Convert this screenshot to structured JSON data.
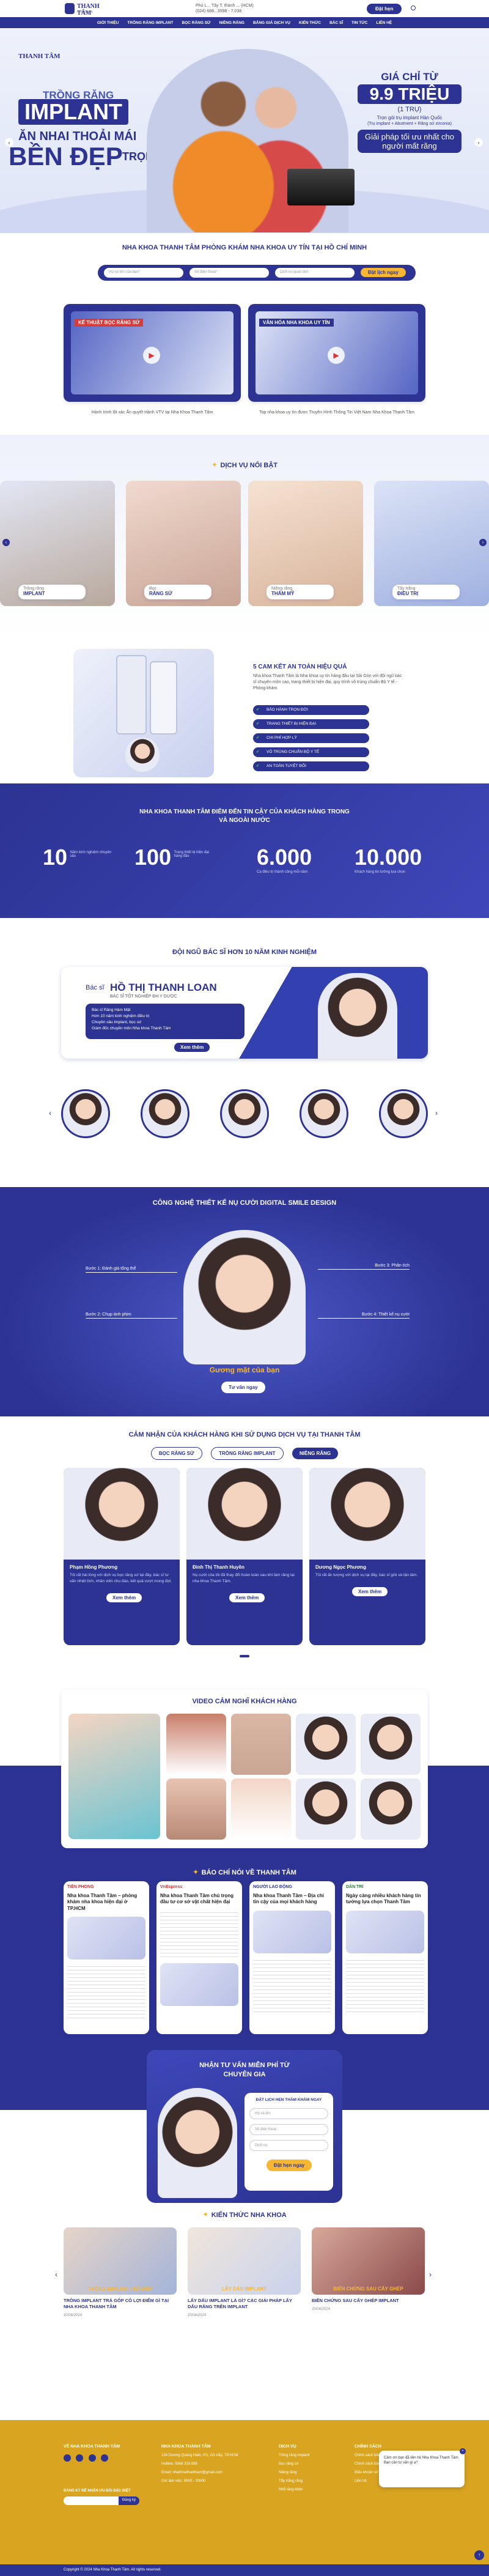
{
  "topbar": {
    "brand": "THANH TÂM",
    "sub": "NHA KHOA",
    "addr": "Phú L... Tây T. thành ... (HCM)",
    "phone": "(024) 688...3598 - 7.038",
    "cta": "Đặt hẹn"
  },
  "nav": [
    "GIỚI THIỆU",
    "TRỒNG RĂNG IMPLANT",
    "BỌC RĂNG SỨ",
    "NIỀNG RĂNG",
    "BẢNG GIÁ DỊCH VỤ",
    "KIẾN THỨC",
    "BÁC SĨ",
    "TIN TỨC",
    "LIÊN HỆ"
  ],
  "hero": {
    "brand": "THANH TÂM",
    "l1": "TRỒNG RĂNG",
    "l2": "IMPLANT",
    "l3": "ĂN NHAI THOẢI MÁI",
    "l4": "BỀN ĐẸP",
    "l5": "TRỌN ĐỜI",
    "price_pre": "GIÁ CHỈ TỪ",
    "price": "9.9 TRIỆU",
    "unit": "(1 TRỤ)",
    "p1": "Trọn gói trụ implant Hàn Quốc",
    "p2": "(Trụ implant + Abutment + Răng sứ zirconia)",
    "p3": "Giải pháp tối ưu nhất cho",
    "p4": "người mất răng"
  },
  "intro": {
    "title": "NHA KHOA THANH TÂM PHÒNG KHÁM NHA KHOA UY TÍN TẠI HỒ CHÍ MINH",
    "f1": "Họ và tên của bạn*",
    "f2": "Số điện thoại*",
    "f3": "Dịch vụ quan tâm",
    "btn": "Đặt lịch ngay"
  },
  "videos": [
    {
      "title": "KẾ THUẬT BỌC RĂNG SỨ",
      "cap": "Hành trình lột xác Ấn quyết Hành VTV tại Nha Khoa Thanh Tâm"
    },
    {
      "title": "VĂN HÓA NHA KHOA UY TÍN",
      "cap": "Top nha khoa uy tín được Truyền Hình Thông Tin Việt Nam Nha Khoa Thanh Tâm"
    }
  ],
  "services": {
    "title": "DỊCH VỤ NỔI BẬT",
    "items": [
      {
        "pre": "Trồng răng",
        "name": "IMPLANT"
      },
      {
        "pre": "Bọc",
        "name": "RĂNG SỨ"
      },
      {
        "pre": "Niềng răng",
        "name": "THẨM MỸ"
      },
      {
        "pre": "Tẩy trắng",
        "name": "ĐIỀU TRỊ"
      }
    ]
  },
  "commit": {
    "title": "5 CAM KẾT AN TOÀN HIỆU QUẢ",
    "desc": "Nha khoa Thanh Tâm là Nha khoa uy tín hàng đầu tại Sài Gòn với đội ngũ bác sĩ chuyên môn cao, trang thiết bị hiện đại, quy trình vô trùng chuẩn Bộ Y tế - Phòng khám",
    "items": [
      "BẢO HÀNH TRỌN ĐỜI",
      "TRANG THIẾT BỊ HIỆN ĐẠI",
      "CHI PHÍ HỢP LÝ",
      "VÔ TRÙNG CHUẨN BỘ Y TẾ",
      "AN TOÀN TUYỆT ĐỐI"
    ]
  },
  "stats": {
    "title": "NHA KHOA THANH TÂM ĐIỂM ĐẾN TIN CẬY CỦA KHÁCH HÀNG TRONG VÀ NGOÀI NƯỚC",
    "items": [
      {
        "num": "10",
        "label": "Năm kinh nghiệm chuyên sâu"
      },
      {
        "num": "100",
        "label": "Trang thiết bị hiện đại hàng đầu"
      },
      {
        "num": "6.000",
        "label": "Ca điều trị thành công mỗi năm"
      },
      {
        "num": "10.000",
        "label": "Khách hàng tin tưởng lựa chọn"
      }
    ]
  },
  "doctor": {
    "title": "ĐỘI NGŨ BÁC SĨ HƠN 10 NĂM KINH NGHIỆM",
    "pre": "Bác sĩ",
    "name": "HỒ THỊ THANH LOAN",
    "role": "BÁC SĨ TỐT NGHIỆP ĐH Y DƯỢC",
    "lines": [
      "Bác sĩ Răng Hàm Mặt",
      "Hơn 10 năm kinh nghiệm điều trị",
      "Chuyên sâu Implant, bọc sứ",
      "Giám đốc chuyên môn Nha khoa Thanh Tâm"
    ],
    "btn": "Xem thêm"
  },
  "dsd": {
    "title": "CÔNG NGHỆ THIẾT KẾ NỤ CƯỜI DIGITAL SMILE DESIGN",
    "l1": "Bước 1: Đánh giá tổng thể",
    "l2": "Bước 2: Chụp ảnh phim",
    "r1": "Bước 3: Phân tích",
    "r2": "Bước 4: Thiết kế nụ cười",
    "cap": "Gương mặt của bạn",
    "btn": "Tư vấn ngay"
  },
  "reviews": {
    "title": "CẢM NHẬN CỦA KHÁCH HÀNG KHI SỬ DỤNG DỊCH VỤ TẠI THANH TÂM",
    "tabs": [
      "BỌC RĂNG SỨ",
      "TRỒNG RĂNG IMPLANT",
      "NIỀNG RĂNG"
    ],
    "items": [
      {
        "name": "Phạm Hồng Phương",
        "txt": "Tôi rất hài lòng với dịch vụ bọc răng sứ tại đây, bác sĩ tư vấn nhiệt tình, nhân viên chu đáo, kết quả vượt mong đợi."
      },
      {
        "name": "Đinh Thị Thanh Huyền",
        "txt": "Nụ cười của tôi đã thay đổi hoàn toàn sau khi làm răng tại nha khoa Thanh Tâm."
      },
      {
        "name": "Dương Ngọc Phương",
        "txt": "Tôi rất ấn tượng với dịch vụ tại đây, bác sĩ giỏi và tận tâm."
      }
    ],
    "more": "Xem thêm"
  },
  "vid2": {
    "title": "VIDEO CẢM NGHĨ KHÁCH HÀNG"
  },
  "press": {
    "title": "BÁO CHÍ NÓI VỀ THANH TÂM",
    "items": [
      {
        "src": "TIỀN PHONG",
        "title": "Nha khoa Thanh Tâm – phòng khám nha khoa hiện đại ở TP.HCM"
      },
      {
        "src": "VnExpress",
        "title": "Nha khoa Thanh Tâm chú trọng đầu tư cơ sở vật chất hiện đại"
      },
      {
        "src": "NGƯỜI LAO ĐỘNG",
        "title": "Nha khoa Thanh Tâm – Địa chỉ tin cậy của mọi khách hàng"
      },
      {
        "src": "DÂN TRÍ",
        "title": "Ngày càng nhiều khách hàng tin tưởng lựa chọn Thanh Tâm"
      }
    ]
  },
  "consult": {
    "title": "NHẬN TƯ VẤN MIỄN PHÍ TỪ",
    "title2": "CHUYÊN GIA",
    "form_title": "ĐẶT LỊCH HẸN THĂM KHÁM NGAY",
    "f1": "Họ và tên",
    "f2": "Số điện thoại",
    "f3": "Dịch vụ",
    "btn": "Đặt hẹn ngay"
  },
  "knowledge": {
    "title": "KIẾN THỨC NHA KHOA",
    "items": [
      {
        "tag": "TRỒNG IMPLANT TRẢ GÓP",
        "title": "TRỒNG IMPLANT TRẢ GÓP CÓ LỢI ĐIỂM GÌ TẠI NHA KHOA THANH TÂM",
        "date": "20/04/2024"
      },
      {
        "tag": "LẤY DẤU IMPLANT",
        "title": "LẤY DẤU IMPLANT LÀ GÌ? CÁC GIẢI PHÁP LẤY DẤU RĂNG TRÊN IMPLANT",
        "date": "20/04/2024"
      },
      {
        "tag": "BIẾN CHỨNG SAU CẤY GHÉP",
        "title": "BIẾN CHỨNG SAU CẤY GHÉP IMPLANT",
        "date": "20/04/2024"
      }
    ]
  },
  "footer": {
    "c1t": "VỀ NHA KHOA THANH TÂM",
    "c1sub": "ĐĂNG KÝ ĐỂ NHẬN ƯU ĐÃI ĐẶC BIỆT",
    "c1btn": "Đăng ký",
    "c2t": "NHA KHOA THANH TÂM",
    "c2": [
      "124 Dương Quảng Hàm, P.5, Gò Vấp, TP.HCM",
      "Hotline: 0968 333 898",
      "Email: nhakhoathanhtam@gmail.com",
      "Giờ làm việc: 8h00 - 20h00"
    ],
    "c3t": "DỊCH VỤ",
    "c3": [
      "Trồng răng Implant",
      "Bọc răng sứ",
      "Niềng răng",
      "Tẩy trắng răng",
      "Nhổ răng khôn"
    ],
    "c4t": "CHÍNH SÁCH",
    "c4": [
      "Chính sách bảo mật",
      "Chính sách bảo hành",
      "Điều khoản sử dụng",
      "Liên hệ"
    ],
    "copy": "Copyright © 2024 Nha Khoa Thanh Tâm. All rights reserved.",
    "chat": "Cảm ơn bạn đã liên hệ Nha Khoa Thanh Tâm. Bạn cần tư vấn gì ạ?"
  },
  "colors": {
    "primary": "#2c3393",
    "accent": "#f7b733",
    "bg": "#f3f5fb"
  }
}
